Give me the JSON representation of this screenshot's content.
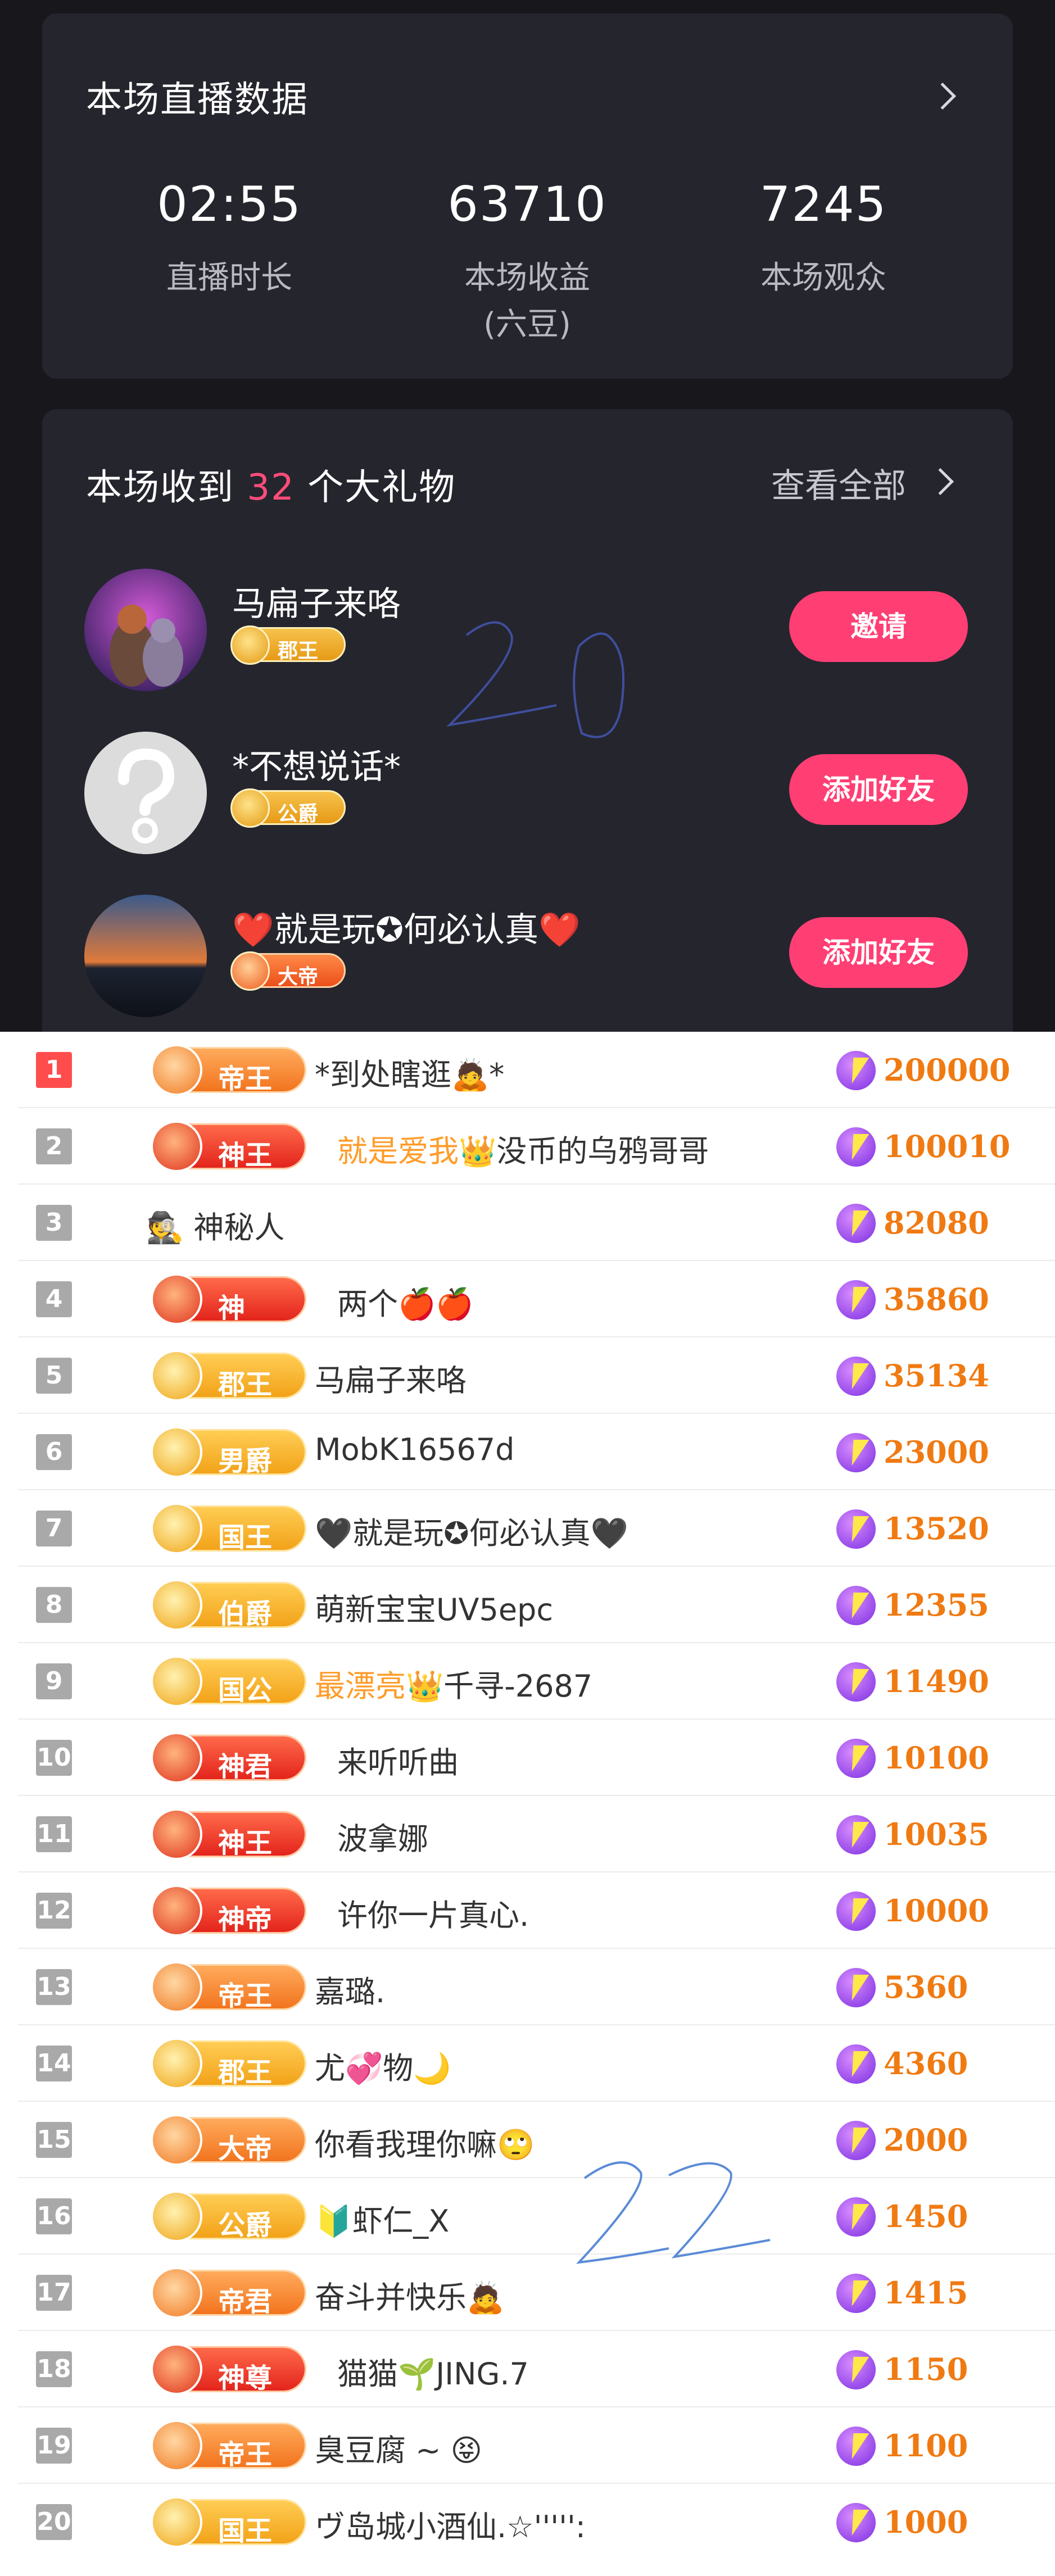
{
  "stats_card": {
    "title": "本场直播数据",
    "items": [
      {
        "value": "02:55",
        "label": "直播时长",
        "sub": ""
      },
      {
        "value": "63710",
        "label": "本场收益",
        "sub": "(六豆)"
      },
      {
        "value": "7245",
        "label": "本场观众",
        "sub": ""
      }
    ]
  },
  "gifts_card": {
    "title_prefix": "本场收到 ",
    "count": "32",
    "title_suffix": " 个大礼物",
    "view_all": "查看全部",
    "givers": [
      {
        "name": "马扁子来咯",
        "badge": "郡王",
        "badge_color": "#f0a21a",
        "button": "邀请"
      },
      {
        "name": "*不想说话*",
        "badge": "公爵",
        "badge_color": "#f0a21a",
        "button": "添加好友"
      },
      {
        "name": "❤️就是玩✪何必认真❤️",
        "badge": "大帝",
        "badge_color": "#ee5b1e",
        "button": "添加好友"
      }
    ]
  },
  "ranking": [
    {
      "rank": "1",
      "level": "帝王",
      "tier": "orange",
      "name": "*到处瞎逛",
      "emoji": "🙇",
      "tail": "*",
      "amount": "200000"
    },
    {
      "rank": "2",
      "level": "神王",
      "tier": "red",
      "name_highlight": "就是爱我",
      "emoji": "👑",
      "name": "没币的乌鸦哥哥",
      "amount": "100010"
    },
    {
      "rank": "3",
      "level": "",
      "tier": "none",
      "emoji": "🕵",
      "name": "神秘人",
      "amount": "82080"
    },
    {
      "rank": "4",
      "level": "神",
      "tier": "red",
      "name": "两个",
      "emoji": "🍎🍎",
      "amount": "35860"
    },
    {
      "rank": "5",
      "level": "郡王",
      "tier": "gold",
      "name": "马扁子来咯",
      "amount": "35134"
    },
    {
      "rank": "6",
      "level": "男爵",
      "tier": "gold",
      "name": "MobK16567d",
      "amount": "23000"
    },
    {
      "rank": "7",
      "level": "国王",
      "tier": "gold",
      "name": "🖤就是玩✪何必认真🖤",
      "amount": "13520"
    },
    {
      "rank": "8",
      "level": "伯爵",
      "tier": "gold",
      "name": "萌新宝宝UV5epc",
      "amount": "12355"
    },
    {
      "rank": "9",
      "level": "国公",
      "tier": "gold",
      "name_highlight": "最漂亮",
      "emoji": "👑",
      "name": "千寻-2687",
      "amount": "11490"
    },
    {
      "rank": "10",
      "level": "神君",
      "tier": "red",
      "name": "来听听曲",
      "amount": "10100"
    },
    {
      "rank": "11",
      "level": "神王",
      "tier": "red",
      "name": "波拿娜",
      "amount": "10035"
    },
    {
      "rank": "12",
      "level": "神帝",
      "tier": "red",
      "name": "许你一片真心.",
      "amount": "10000"
    },
    {
      "rank": "13",
      "level": "帝王",
      "tier": "orange",
      "name": "嘉璐.",
      "amount": "5360"
    },
    {
      "rank": "14",
      "level": "郡王",
      "tier": "gold",
      "name": "尤💞物🌙",
      "amount": "4360"
    },
    {
      "rank": "15",
      "level": "大帝",
      "tier": "orange",
      "name": "你看我理你嘛",
      "emoji": "🙄",
      "amount": "2000"
    },
    {
      "rank": "16",
      "level": "公爵",
      "tier": "gold",
      "name": "🔰虾仁_X",
      "amount": "1450"
    },
    {
      "rank": "17",
      "level": "帝君",
      "tier": "orange",
      "name": "奋斗并快乐",
      "emoji": "🙇",
      "amount": "1415"
    },
    {
      "rank": "18",
      "level": "神尊",
      "tier": "red",
      "name": "猫猫🌱JING.7",
      "amount": "1150"
    },
    {
      "rank": "19",
      "level": "帝王",
      "tier": "orange",
      "name": "臭豆腐 ~",
      "emoji": "😝",
      "amount": "1100"
    },
    {
      "rank": "20",
      "level": "国王",
      "tier": "gold",
      "name": "ヴ岛城小酒仙.☆''''':",
      "amount": "1000"
    }
  ],
  "handwritten": {
    "top": "20",
    "bottom": "22"
  },
  "colors": {
    "accent_pink": "#ff3f74",
    "count_red": "#ff4d7a",
    "amount_orange": "#f07a12"
  }
}
